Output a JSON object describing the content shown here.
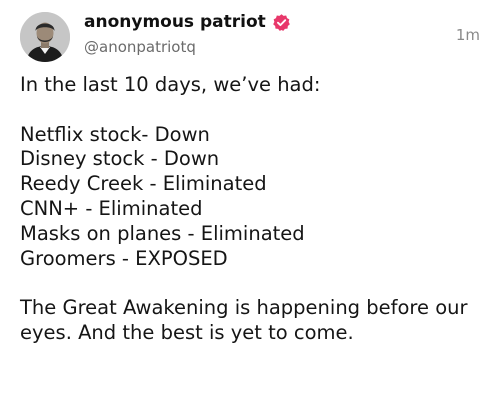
{
  "author": {
    "display_name": "anonymous patriot",
    "handle": "@anonpatriotq",
    "avatar_icon": "portrait-avatar",
    "verified_icon": "verified-badge-icon",
    "verified_color": "#e8386b"
  },
  "post": {
    "timestamp": "1m",
    "intro": "In the last 10 days, we’ve had:",
    "items": [
      "Netflix stock- Down",
      "Disney stock - Down",
      "Reedy Creek - Eliminated",
      "CNN+ - Eliminated",
      "Masks on planes - Eliminated",
      "Groomers - EXPOSED"
    ],
    "closing_lines": [
      "The Great Awakening is happening before our",
      "eyes. And the best is yet to come."
    ]
  }
}
